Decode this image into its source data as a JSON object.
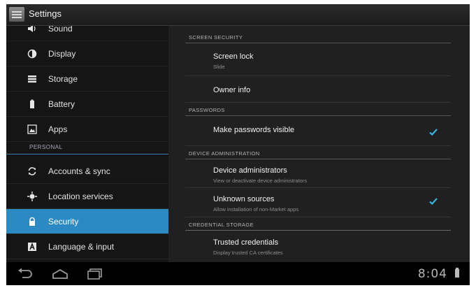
{
  "window": {
    "title": "Settings"
  },
  "sidebar": {
    "items": [
      {
        "label": "Sound",
        "icon": "speaker-icon"
      },
      {
        "label": "Display",
        "icon": "display-icon"
      },
      {
        "label": "Storage",
        "icon": "storage-icon"
      },
      {
        "label": "Battery",
        "icon": "battery-icon"
      },
      {
        "label": "Apps",
        "icon": "apps-icon"
      }
    ],
    "personal_header": "PERSONAL",
    "personal_items": [
      {
        "label": "Accounts & sync",
        "icon": "sync-icon"
      },
      {
        "label": "Location services",
        "icon": "location-icon"
      },
      {
        "label": "Security",
        "icon": "lock-icon",
        "selected": true
      },
      {
        "label": "Language & input",
        "icon": "language-icon"
      }
    ],
    "selected_color": "#2b8ac4"
  },
  "security": {
    "screen_security_header": "SCREEN SECURITY",
    "screen_lock": {
      "title": "Screen lock",
      "summary": "Slide"
    },
    "owner_info": {
      "title": "Owner info"
    },
    "passwords_header": "PASSWORDS",
    "make_passwords_visible": {
      "title": "Make passwords visible",
      "checked": true
    },
    "device_admin_header": "DEVICE ADMINISTRATION",
    "device_administrators": {
      "title": "Device administrators",
      "summary": "View or deactivate device administrators"
    },
    "unknown_sources": {
      "title": "Unknown sources",
      "summary": "Allow installation of non-Market apps",
      "checked": true
    },
    "credential_storage_header": "CREDENTIAL STORAGE",
    "trusted_credentials": {
      "title": "Trusted credentials",
      "summary": "Display trusted CA certificates"
    }
  },
  "status_bar": {
    "clock": "8:04"
  },
  "accent_color": "#33b5e5"
}
